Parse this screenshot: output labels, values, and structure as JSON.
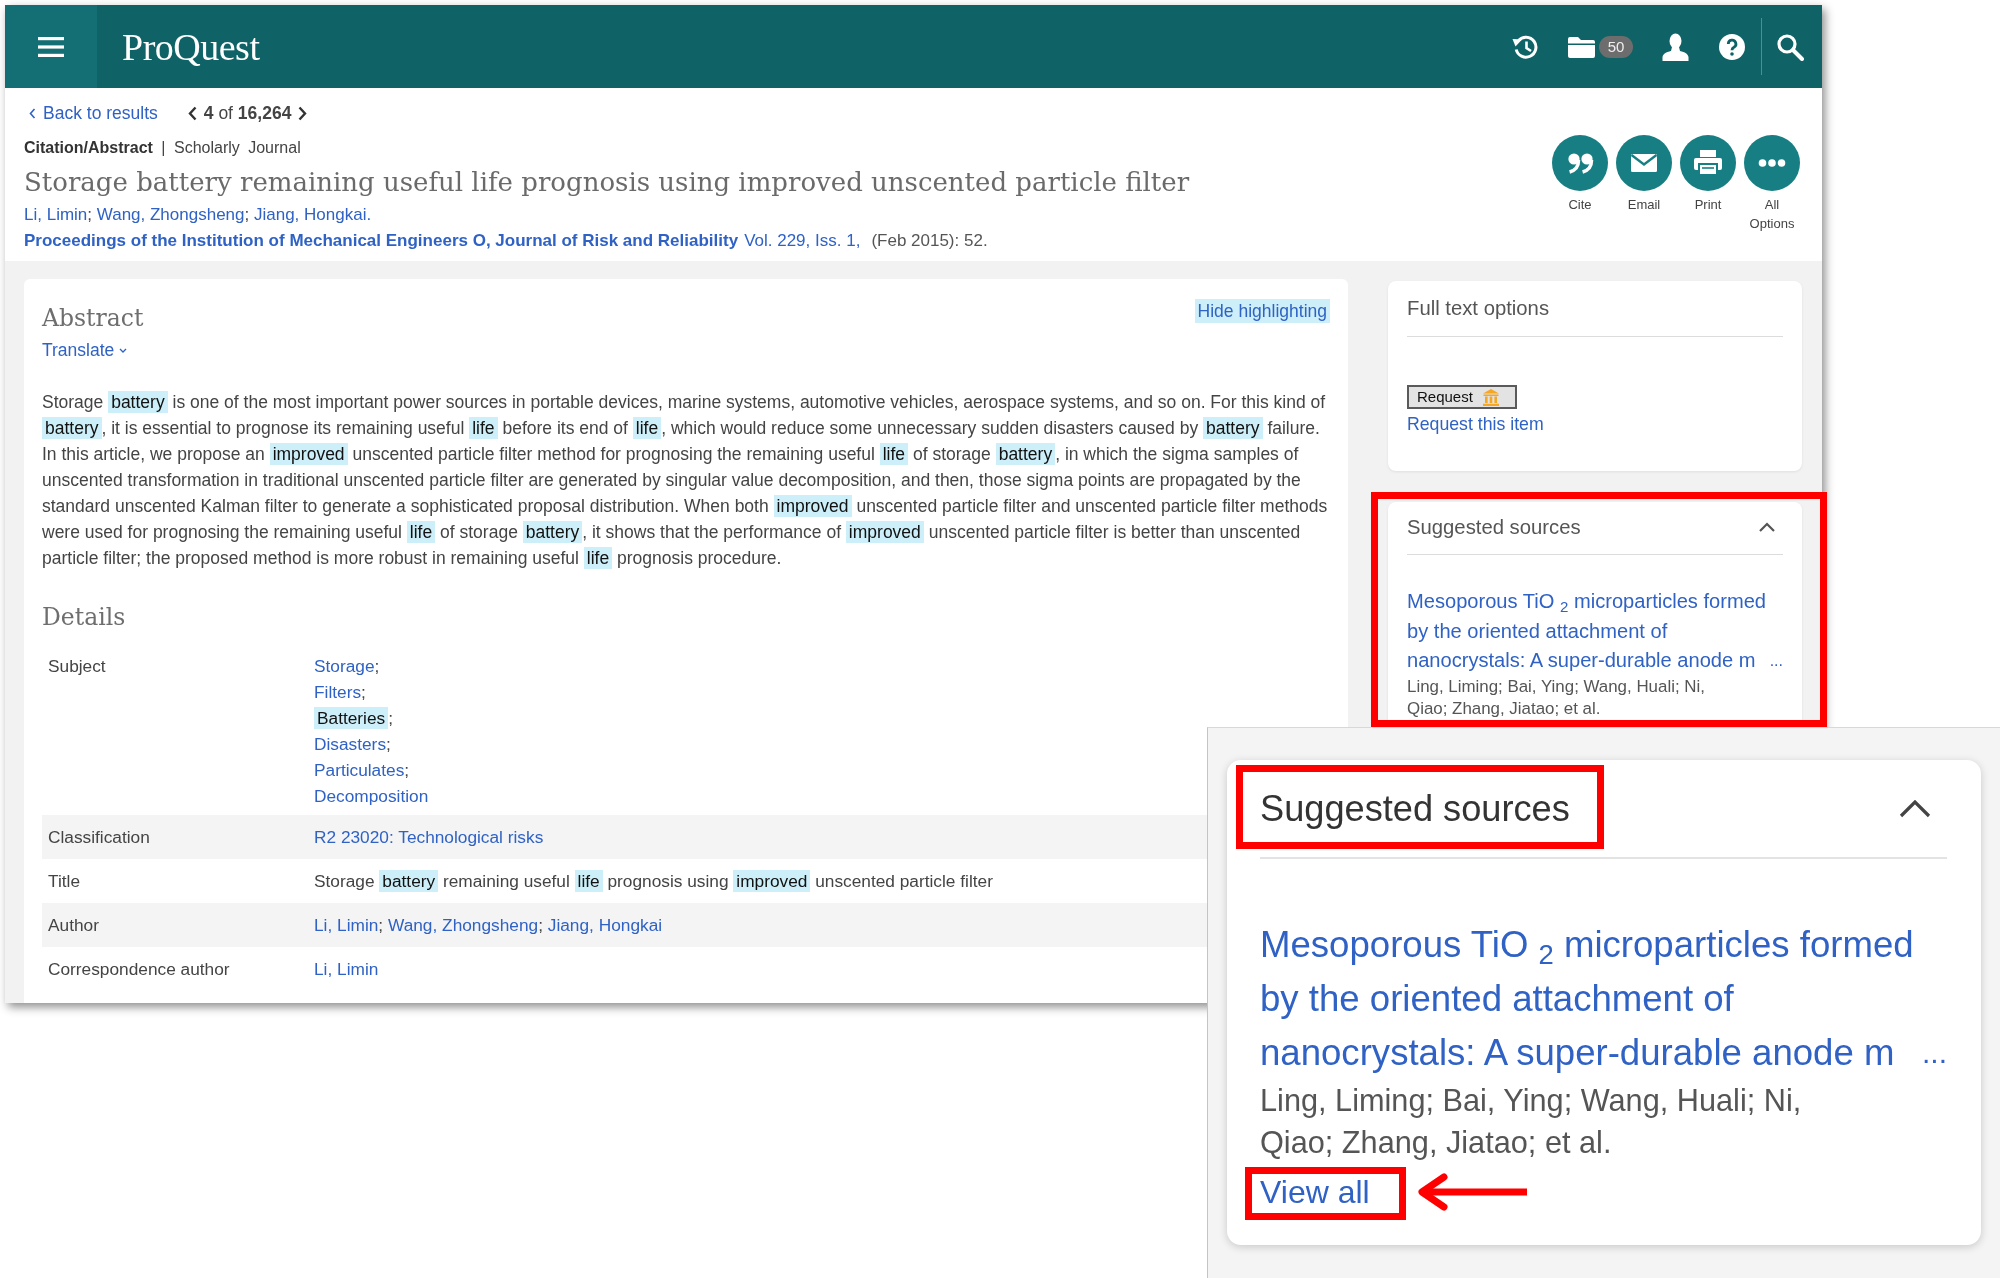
{
  "header": {
    "logo": "ProQuest",
    "folder_count": "50"
  },
  "result_nav": {
    "back_link": "Back to results",
    "position": "**4** of **16,264**"
  },
  "document": {
    "type_line": "**Citation/Abstract** | Scholarly Journal",
    "title": "Storage battery remaining useful life prognosis using improved unscented particle filter",
    "authors": [
      "Li, Limin",
      "Wang, Zhongsheng",
      "Jiang, Hongkai."
    ],
    "author_separator": ";",
    "journal": "Proceedings of the Institution of Mechanical Engineers O, Journal of Risk and Reliability",
    "issue": "Vol. 229, Iss. 1,",
    "date_pages": "(Feb 2015): 52."
  },
  "actions": [
    {
      "kind": "cite",
      "label": "Cite"
    },
    {
      "kind": "email",
      "label": "Email"
    },
    {
      "kind": "print",
      "label": "Print"
    },
    {
      "kind": "more",
      "label": "All Options"
    }
  ],
  "abstract": {
    "heading": "Abstract",
    "translate_link": "Translate",
    "hide_highlighting": "Hide highlighting",
    "segments": [
      {
        "text": "Storage ",
        "highlighted": false
      },
      {
        "text": "battery",
        "highlighted": true
      },
      {
        "text": " is one of the most important power sources in portable devices, marine systems, automotive vehicles, aerospace systems, and so on. For this kind of ",
        "highlighted": false
      },
      {
        "text": "battery",
        "highlighted": true
      },
      {
        "text": ", it is essential to prognose its remaining useful ",
        "highlighted": false
      },
      {
        "text": "life",
        "highlighted": true
      },
      {
        "text": " before its end of ",
        "highlighted": false
      },
      {
        "text": "life",
        "highlighted": true
      },
      {
        "text": ", which would reduce some unnecessary sudden disasters caused by ",
        "highlighted": false
      },
      {
        "text": "battery",
        "highlighted": true
      },
      {
        "text": " failure. In this article, we propose an ",
        "highlighted": false
      },
      {
        "text": "improved",
        "highlighted": true
      },
      {
        "text": " unscented particle filter method for prognosing the remaining useful ",
        "highlighted": false
      },
      {
        "text": "life",
        "highlighted": true
      },
      {
        "text": " of storage ",
        "highlighted": false
      },
      {
        "text": "battery",
        "highlighted": true
      },
      {
        "text": ", in which the sigma samples of unscented transformation in traditional unscented particle filter are generated by singular value decomposition, and then, those sigma points are propagated by the standard unscented Kalman filter to generate a sophisticated proposal distribution. When both ",
        "highlighted": false
      },
      {
        "text": "improved",
        "highlighted": true
      },
      {
        "text": " unscented particle filter and unscented particle filter methods were used for prognosing the remaining useful ",
        "highlighted": false
      },
      {
        "text": "life",
        "highlighted": true
      },
      {
        "text": " of storage ",
        "highlighted": false
      },
      {
        "text": "battery",
        "highlighted": true
      },
      {
        "text": ", it shows that the performance of ",
        "highlighted": false
      },
      {
        "text": "improved",
        "highlighted": true
      },
      {
        "text": " unscented particle filter is better than unscented particle filter; the proposed method is more robust in remaining useful ",
        "highlighted": false
      },
      {
        "text": "life",
        "highlighted": true
      },
      {
        "text": " prognosis procedure.",
        "highlighted": false
      }
    ]
  },
  "details": {
    "heading": "Details",
    "rows": [
      {
        "kind": "terms",
        "label": "Subject",
        "separator": ";",
        "terms": [
          {
            "text": "Storage",
            "highlighted": false
          },
          {
            "text": "Filters",
            "highlighted": false
          },
          {
            "text": "Batteries",
            "highlighted": true
          },
          {
            "text": "Disasters",
            "highlighted": false
          },
          {
            "text": "Particulates",
            "highlighted": false
          },
          {
            "text": "Decomposition",
            "highlighted": false
          }
        ]
      },
      {
        "kind": "links",
        "label": "Classification",
        "links": [
          "R2 23020: Technological risks"
        ]
      },
      {
        "kind": "text",
        "label": "Title",
        "segments": [
          {
            "text": "Storage ",
            "highlighted": false
          },
          {
            "text": "battery",
            "highlighted": true
          },
          {
            "text": " remaining useful ",
            "highlighted": false
          },
          {
            "text": "life",
            "highlighted": true
          },
          {
            "text": " prognosis using ",
            "highlighted": false
          },
          {
            "text": "improved",
            "highlighted": true
          },
          {
            "text": " unscented particle filter",
            "highlighted": false
          }
        ]
      },
      {
        "kind": "links",
        "label": "Author",
        "separator": ";",
        "links": [
          "Li, Limin",
          "Wang, Zhongsheng",
          "Jiang, Hongkai"
        ]
      },
      {
        "kind": "links",
        "label": "Correspondence author",
        "links": [
          "Li, Limin"
        ]
      }
    ]
  },
  "full_text_options": {
    "heading": "Full text options",
    "request_button": "Request",
    "request_link": "Request this item"
  },
  "suggested_sources": {
    "heading": "Suggested sources",
    "expanded": true,
    "highlighted": true,
    "items": [
      {
        "title": "Mesoporous TiO $_{2}$ microparticles formed by the oriented attachment of nanocrystals: A super-durable anode m",
        "ellipsis": "...",
        "authors": "Ling, Liming; Bai, Ying; Wang, Huali; Ni, Qiao; Zhang, Jiatao; et al."
      }
    ]
  },
  "zoom_inset": {
    "heading": "Suggested sources",
    "heading_highlighted": true,
    "expanded": true,
    "items": [
      {
        "title": "Mesoporous TiO $_{2}$ microparticles formed by the oriented attachment of nanocrystals: A super-durable anode m",
        "ellipsis": "...",
        "authors": "Ling, Liming; Bai, Ying; Wang, Huali; Ni, Qiao; Zhang, Jiatao; et al."
      }
    ],
    "view_all": {
      "label": "View all",
      "highlighted": true,
      "pointer_arrow": true
    }
  }
}
